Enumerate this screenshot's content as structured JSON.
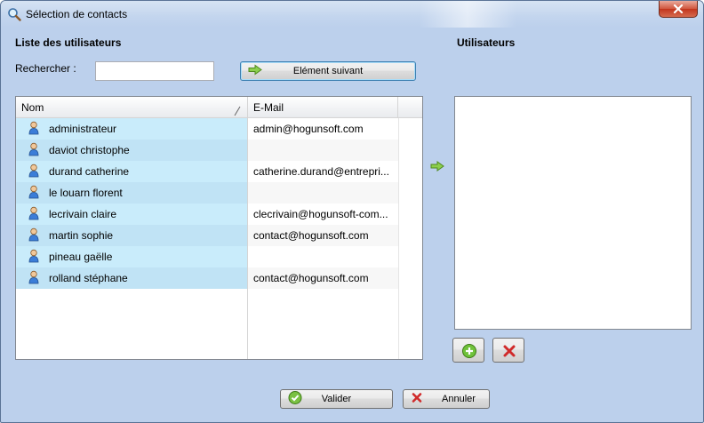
{
  "window": {
    "title": "Sélection de contacts",
    "icon": "magnifier-icon"
  },
  "left_panel": {
    "title": "Liste des utilisateurs",
    "search_label": "Rechercher :",
    "search_value": "",
    "next_button_label": "Elément suivant"
  },
  "grid": {
    "columns": [
      "Nom",
      "E-Mail"
    ],
    "rows": [
      {
        "name": "administrateur",
        "email": "admin@hogunsoft.com"
      },
      {
        "name": "daviot christophe",
        "email": ""
      },
      {
        "name": "durand catherine",
        "email": "catherine.durand@entrepri..."
      },
      {
        "name": "le louarn florent",
        "email": ""
      },
      {
        "name": "lecrivain claire",
        "email": "clecrivain@hogunsoft-com..."
      },
      {
        "name": "martin sophie",
        "email": "contact@hogunsoft.com"
      },
      {
        "name": "pineau gaëlle",
        "email": ""
      },
      {
        "name": "rolland stéphane",
        "email": "contact@hogunsoft.com"
      }
    ]
  },
  "right_panel": {
    "title": "Utilisateurs",
    "items": []
  },
  "footer": {
    "ok_label": "Valider",
    "cancel_label": "Annuler"
  },
  "colors": {
    "dialog_bg": "#bcd0ec",
    "name_cell": "#c9ecfb",
    "arrow_green": "#7ac142"
  }
}
